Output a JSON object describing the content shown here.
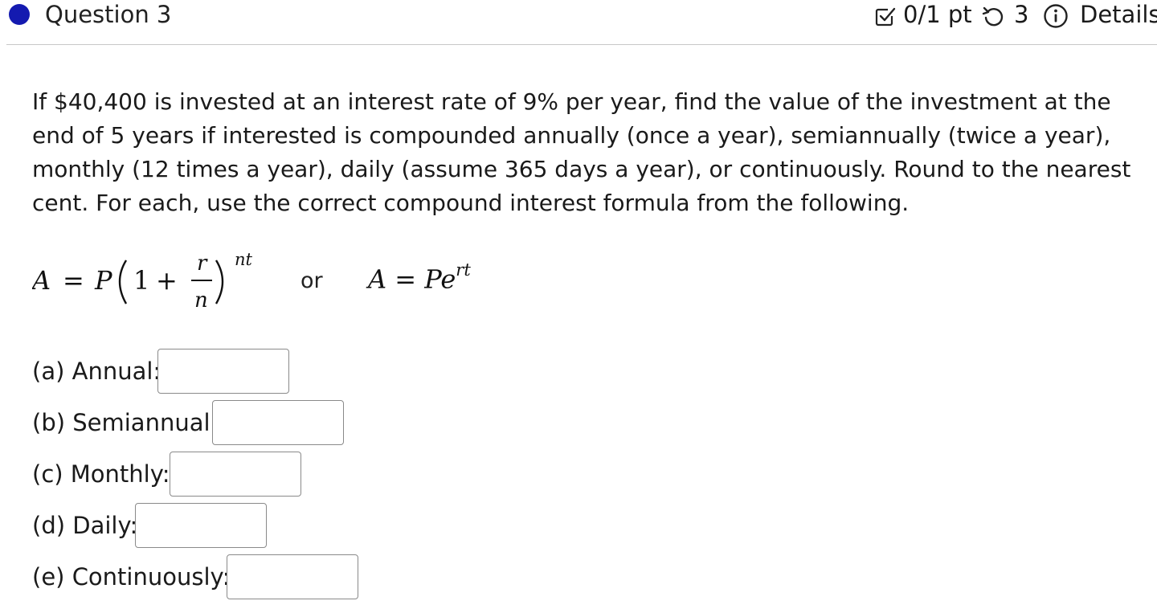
{
  "header": {
    "question_title": "Question 3",
    "score": "0/1 pt",
    "retries": "3",
    "details_label": "Details",
    "icons": [
      "question-status-dot",
      "score-checkbox-icon",
      "retry-icon",
      "info-icon"
    ],
    "status_dot_color": "#141ab0"
  },
  "question": {
    "text": "If $40,400 is invested at an interest rate of 9% per year, find the value of the investment at the end of 5 years if interested is compounded annually (once a year), semiannually (twice a year), monthly (12 times a year), daily (assume 365 days a year), or continuously. Round to the nearest cent. For each, use the correct compound interest formula from the following."
  },
  "formula": {
    "left_lhs": "A",
    "left_eq": "=",
    "left_P": "P",
    "left_one": "1",
    "left_plus": "+",
    "left_num": "r",
    "left_den": "n",
    "left_exp": "nt",
    "or": "or",
    "right_lhs": "A",
    "right_eq": "=",
    "right_base": "Pe",
    "right_exp": "rt"
  },
  "answers": [
    {
      "label": "(a) Annual:",
      "value": ""
    },
    {
      "label": "(b) Semiannual:",
      "value": ""
    },
    {
      "label": "(c) Monthly:",
      "value": ""
    },
    {
      "label": "(d) Daily:",
      "value": ""
    },
    {
      "label": "(e) Continuously:",
      "value": ""
    }
  ]
}
